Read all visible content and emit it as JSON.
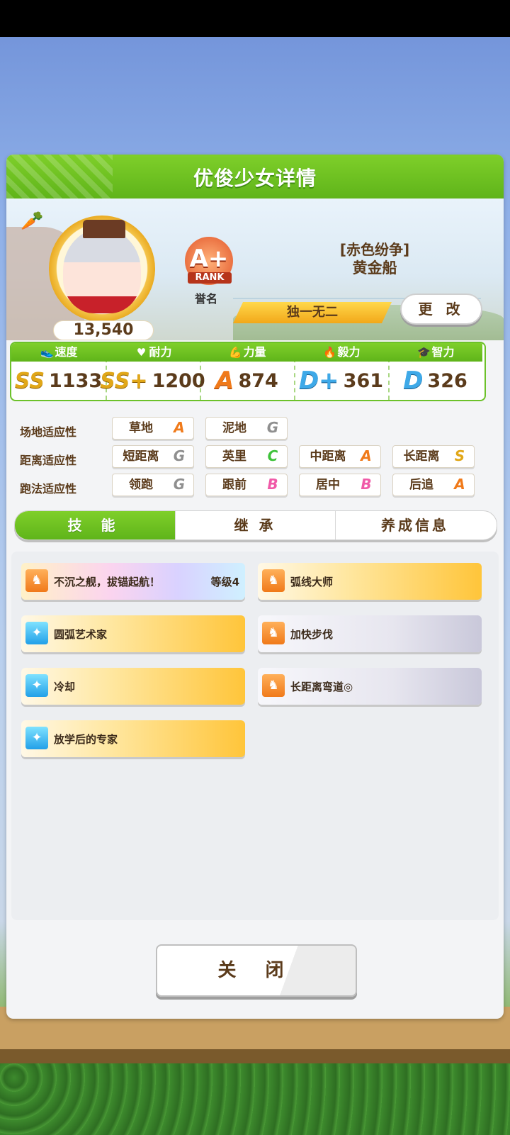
{
  "header": {
    "title": "优俊少女详情"
  },
  "profile": {
    "fans": "13,540",
    "rank": {
      "grade": "A+",
      "word": "RANK",
      "label": "誉名"
    },
    "epithet": "[赤色纷争]",
    "name": "黄金船",
    "unique_label": "独一无二",
    "change_button": "更 改"
  },
  "stats": [
    {
      "label": "速度",
      "icon": "shoe-icon",
      "grade": "SS",
      "value": "1133"
    },
    {
      "label": "耐力",
      "icon": "heart-icon",
      "grade": "SS+",
      "value": "1200"
    },
    {
      "label": "力量",
      "icon": "muscle-icon",
      "grade": "A",
      "value": "874"
    },
    {
      "label": "毅力",
      "icon": "flame-icon",
      "grade": "D+",
      "value": "361"
    },
    {
      "label": "智力",
      "icon": "cap-icon",
      "grade": "D",
      "value": "326"
    }
  ],
  "aptitude": {
    "track": {
      "label": "场地适应性",
      "items": [
        {
          "name": "草地",
          "grade": "A"
        },
        {
          "name": "泥地",
          "grade": "G"
        }
      ]
    },
    "distance": {
      "label": "距离适应性",
      "items": [
        {
          "name": "短距离",
          "grade": "G"
        },
        {
          "name": "英里",
          "grade": "C"
        },
        {
          "name": "中距离",
          "grade": "A"
        },
        {
          "name": "长距离",
          "grade": "S"
        }
      ]
    },
    "style": {
      "label": "跑法适应性",
      "items": [
        {
          "name": "领跑",
          "grade": "G"
        },
        {
          "name": "跟前",
          "grade": "B"
        },
        {
          "name": "居中",
          "grade": "B"
        },
        {
          "name": "后追",
          "grade": "A"
        }
      ]
    }
  },
  "tabs": [
    "技 能",
    "继 承",
    "养成信息"
  ],
  "skills": [
    {
      "name": "不沉之舰，拔锚起航！",
      "level": "等级4",
      "style": "rainbow",
      "icon": "horse-icon"
    },
    {
      "name": "弧线大师",
      "style": "gold",
      "icon": "horse-icon"
    },
    {
      "name": "圆弧艺术家",
      "style": "gold",
      "icon": "sparkle-icon"
    },
    {
      "name": "加快步伐",
      "style": "white",
      "icon": "horse-icon"
    },
    {
      "name": "冷却",
      "style": "gold",
      "icon": "sparkle-icon"
    },
    {
      "name": "长距离弯道◎",
      "style": "white",
      "icon": "horse-icon"
    },
    {
      "name": "放学后的专家",
      "style": "gold",
      "icon": "sparkle-icon"
    }
  ],
  "close_button": "关 闭",
  "colors": {
    "green": "#6cc12a",
    "brown_text": "#5b3b1b",
    "gold": "#f2a81a"
  }
}
